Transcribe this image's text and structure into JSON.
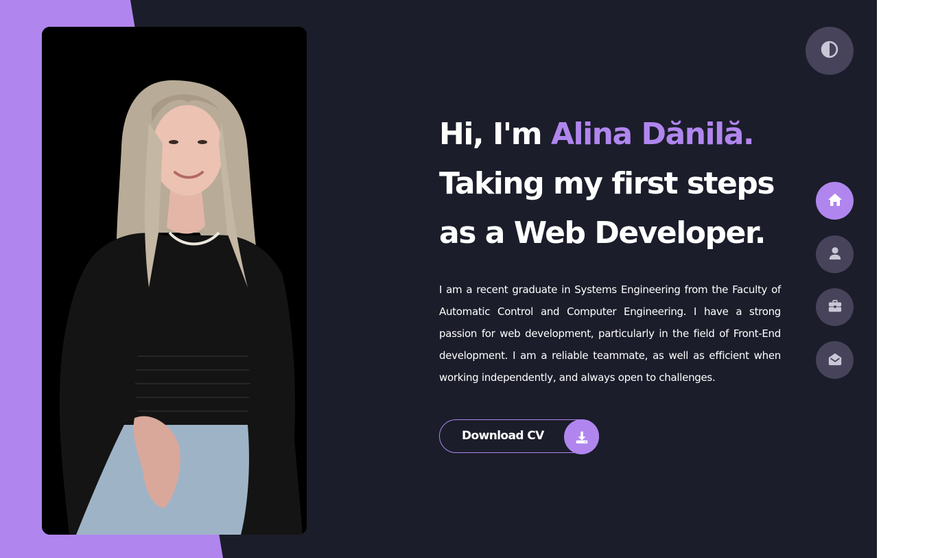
{
  "hero": {
    "greeting": "Hi, I'm ",
    "name": "Alina Dănilă.",
    "line2": "Taking my first steps",
    "line3": "as a Web Developer.",
    "bio": "I am a recent graduate in Systems Engineering from the Faculty of Automatic Control and Computer Engineering. I have a strong passion for web development, particularly in the field of Front-End development. I am a reliable teammate, as well as efficient when working independently, and always open to challenges.",
    "cv_button": {
      "label": "Download CV",
      "icon": "download-icon"
    }
  },
  "theme_toggle": {
    "icon": "contrast-icon"
  },
  "nav": [
    {
      "id": "home",
      "icon": "home-icon",
      "active": true
    },
    {
      "id": "about",
      "icon": "user-icon",
      "active": false
    },
    {
      "id": "portfolio",
      "icon": "briefcase-icon",
      "active": false
    },
    {
      "id": "contact",
      "icon": "envelope-open-icon",
      "active": false
    }
  ],
  "colors": {
    "background": "#1b1d2a",
    "accent": "#b086ee",
    "button_bg": "#46435a",
    "text": "#ffffff",
    "icon_muted": "#c9c7d6"
  }
}
